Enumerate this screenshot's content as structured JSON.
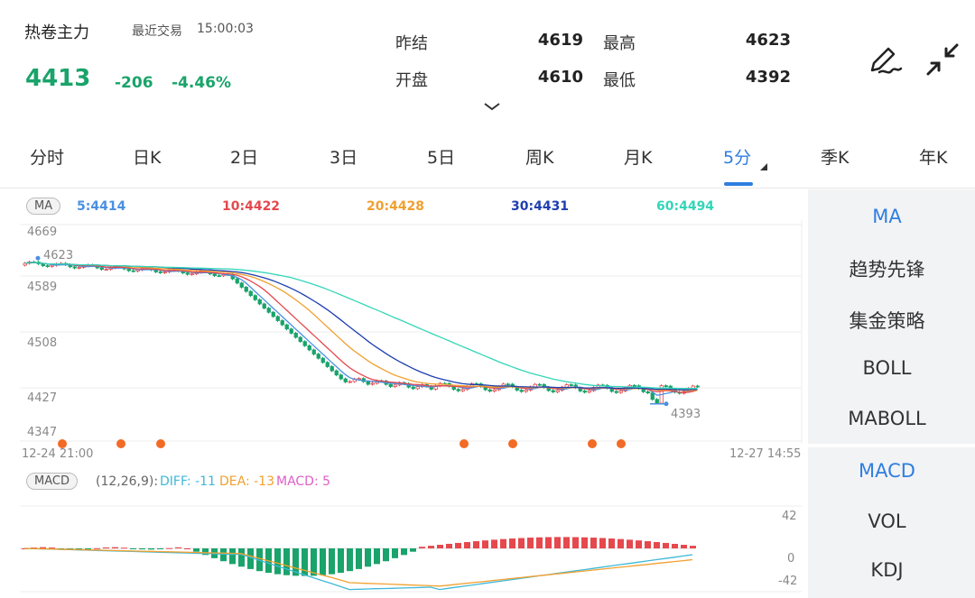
{
  "quote": {
    "name": "热卷主力",
    "trade_label": "最近交易",
    "trade_time": "15:00:03",
    "price": "4413",
    "change": "-206",
    "change_pct": "-4.46%",
    "color_down": "#1aa36a"
  },
  "stats": {
    "prev_settle_label": "昨结",
    "prev_settle": "4619",
    "open_label": "开盘",
    "open": "4610",
    "high_label": "最高",
    "high": "4623",
    "low_label": "最低",
    "low": "4392"
  },
  "icons": {
    "draw": "pen-draw-icon",
    "collapse": "collapse-icon",
    "expand": "chevron-down-icon"
  },
  "tabs": [
    {
      "label": "分时"
    },
    {
      "label": "日K"
    },
    {
      "label": "2日"
    },
    {
      "label": "3日"
    },
    {
      "label": "5日"
    },
    {
      "label": "周K"
    },
    {
      "label": "月K"
    },
    {
      "label": "5分",
      "active": true
    },
    {
      "label": "季K"
    },
    {
      "label": "年K"
    }
  ],
  "ma_bar": {
    "pill": "MA",
    "ma5": "5:4414",
    "ma10": "10:4422",
    "ma20": "20:4428",
    "ma30": "30:4431",
    "ma60": "60:4494",
    "colors": {
      "ma5": "#4a90e2",
      "ma10": "#e5484d",
      "ma20": "#f0a030",
      "ma30": "#1f3fb0",
      "ma60": "#33d6b8"
    }
  },
  "price_axis": [
    "4669",
    "4589",
    "4508",
    "4427",
    "4347"
  ],
  "price_marks": {
    "high": "4623",
    "low": "4393"
  },
  "time_axis": {
    "start": "12-24 21:00",
    "end": "12-27 14:55"
  },
  "macd_bar": {
    "pill": "MACD",
    "params": "(12,26,9):",
    "diff": "DIFF: -11",
    "dea": "DEA: -13",
    "macd": "MACD: 5",
    "colors": {
      "diff": "#3fb8d8",
      "dea": "#f0a030",
      "macd": "#e060c8"
    }
  },
  "macd_axis": [
    "42",
    "0",
    "-42"
  ],
  "side_indicators_top": [
    {
      "label": "MA",
      "active": true
    },
    {
      "label": "趋势先锋"
    },
    {
      "label": "集金策略"
    },
    {
      "label": "BOLL"
    },
    {
      "label": "MABOLL"
    }
  ],
  "side_indicators_bottom": [
    {
      "label": "MACD",
      "active": true
    },
    {
      "label": "VOL"
    },
    {
      "label": "KDJ"
    }
  ]
}
